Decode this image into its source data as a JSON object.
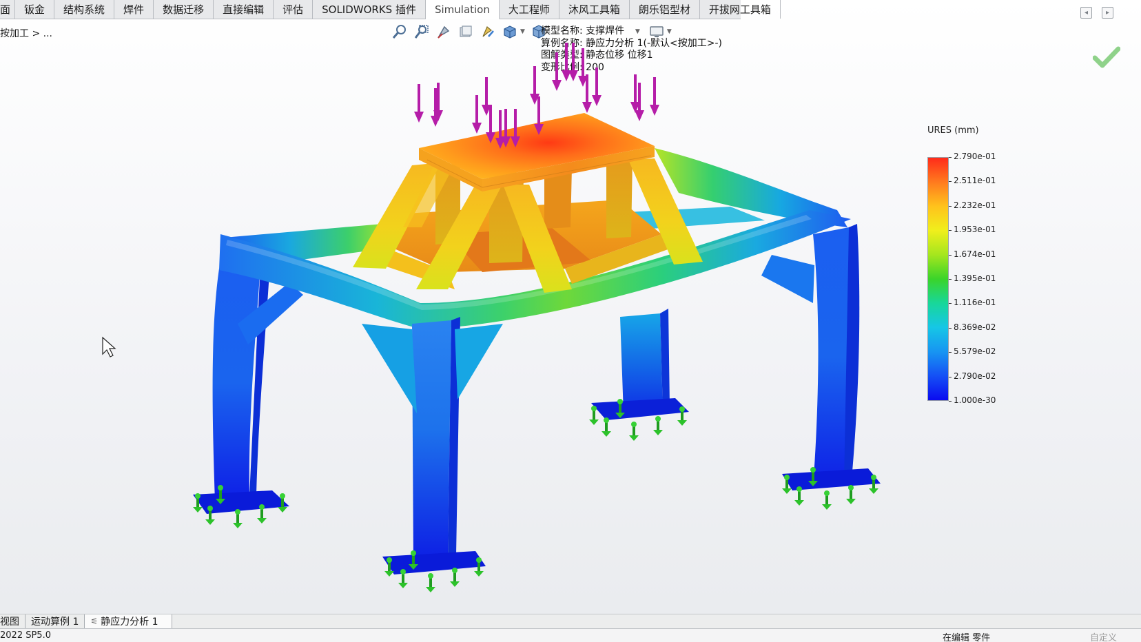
{
  "command_tabs": [
    {
      "label": "面",
      "active": false
    },
    {
      "label": "钣金",
      "active": false
    },
    {
      "label": "结构系统",
      "active": false
    },
    {
      "label": "焊件",
      "active": false
    },
    {
      "label": "数据迁移",
      "active": false
    },
    {
      "label": "直接编辑",
      "active": false
    },
    {
      "label": "评估",
      "active": false
    },
    {
      "label": "SOLIDWORKS 插件",
      "active": false
    },
    {
      "label": "Simulation",
      "active": true
    },
    {
      "label": "大工程师",
      "active": false
    },
    {
      "label": "沐风工具箱",
      "active": false
    },
    {
      "label": "朗乐铝型材",
      "active": false
    },
    {
      "label": "开拔网工具箱",
      "active": false
    }
  ],
  "breadcrumb": "按加工 > ...",
  "study_info": {
    "model_name": "模型名称: 支撑焊件",
    "study_name": "算例名称: 静应力分析 1(-默认<按加工>-)",
    "plot_type": "图解类型: 静态位移 位移1",
    "deform_scale": "变形比例: 200"
  },
  "legend": {
    "title": "URES (mm)",
    "labels": [
      "2.790e-01",
      "2.511e-01",
      "2.232e-01",
      "1.953e-01",
      "1.674e-01",
      "1.395e-01",
      "1.116e-01",
      "8.369e-02",
      "5.579e-02",
      "2.790e-02",
      "1.000e-30"
    ]
  },
  "bottom_tabs": [
    {
      "label": "视图",
      "active": false
    },
    {
      "label": "运动算例 1",
      "active": false
    },
    {
      "label": "静应力分析 1",
      "active": true
    }
  ],
  "status": {
    "version": "2022 SP5.0",
    "mode": "在编辑 零件",
    "custom": "自定义"
  },
  "colors": {
    "accent_check": "#8fd28a",
    "load_arrow": "#b51da8",
    "fixture": "#1bb41b"
  },
  "icons": {
    "window": [
      "restore-down-icon",
      "tile-icon"
    ],
    "hud": [
      "zoom-to-fit-icon",
      "zoom-area-icon",
      "previous-view-icon",
      "section-view-icon",
      "view-orientation-icon",
      "display-style-icon",
      "apply-scene-icon",
      "view-settings-icon"
    ],
    "checkmark": "ok-check-icon",
    "cursor": "pointer-cursor-icon"
  }
}
